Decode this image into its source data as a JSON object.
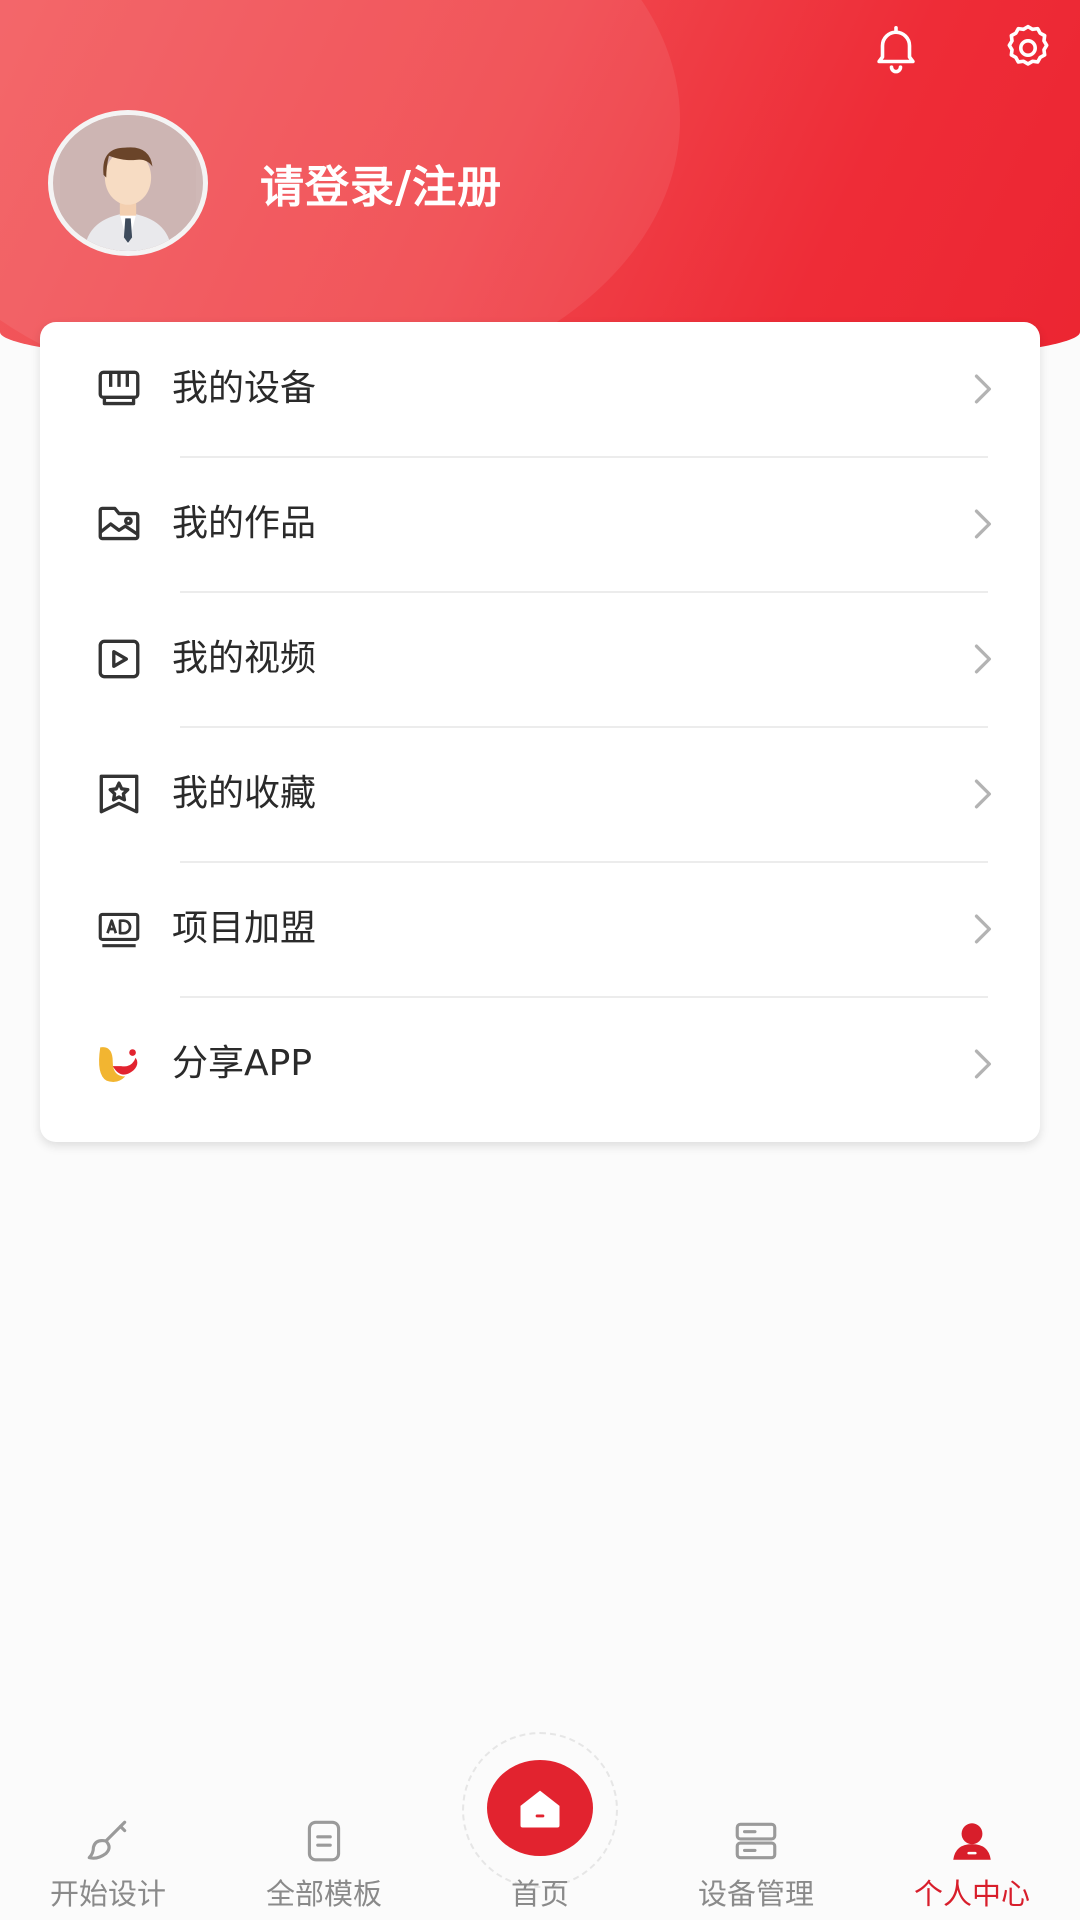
{
  "header": {
    "login_text": "请登录/注册",
    "accent_color": "#ef2f3a",
    "icons": [
      "bell-icon",
      "gear-icon",
      "avatar"
    ]
  },
  "menu": {
    "items": [
      {
        "label": "我的设备",
        "icon": "device-icon"
      },
      {
        "label": "我的作品",
        "icon": "folder-image-icon"
      },
      {
        "label": "我的视频",
        "icon": "play-video-icon"
      },
      {
        "label": "我的收藏",
        "icon": "favorite-star-icon"
      },
      {
        "label": "项目加盟",
        "icon": "ad-icon"
      },
      {
        "label": "分享APP",
        "icon": "app-logo-icon"
      }
    ],
    "arrow_icon": "chevron-right-icon"
  },
  "bottom_nav": {
    "items": [
      {
        "label": "开始设计",
        "icon": "paint-brush-icon",
        "active": false
      },
      {
        "label": "全部模板",
        "icon": "template-icon",
        "active": false
      },
      {
        "label": "首页",
        "icon": "home-icon",
        "active": false
      },
      {
        "label": "设备管理",
        "icon": "server-icon",
        "active": false
      },
      {
        "label": "个人中心",
        "icon": "person-icon",
        "active": true
      }
    ],
    "active_color": "#d81e2b",
    "inactive_color": "#8a8a8a"
  }
}
